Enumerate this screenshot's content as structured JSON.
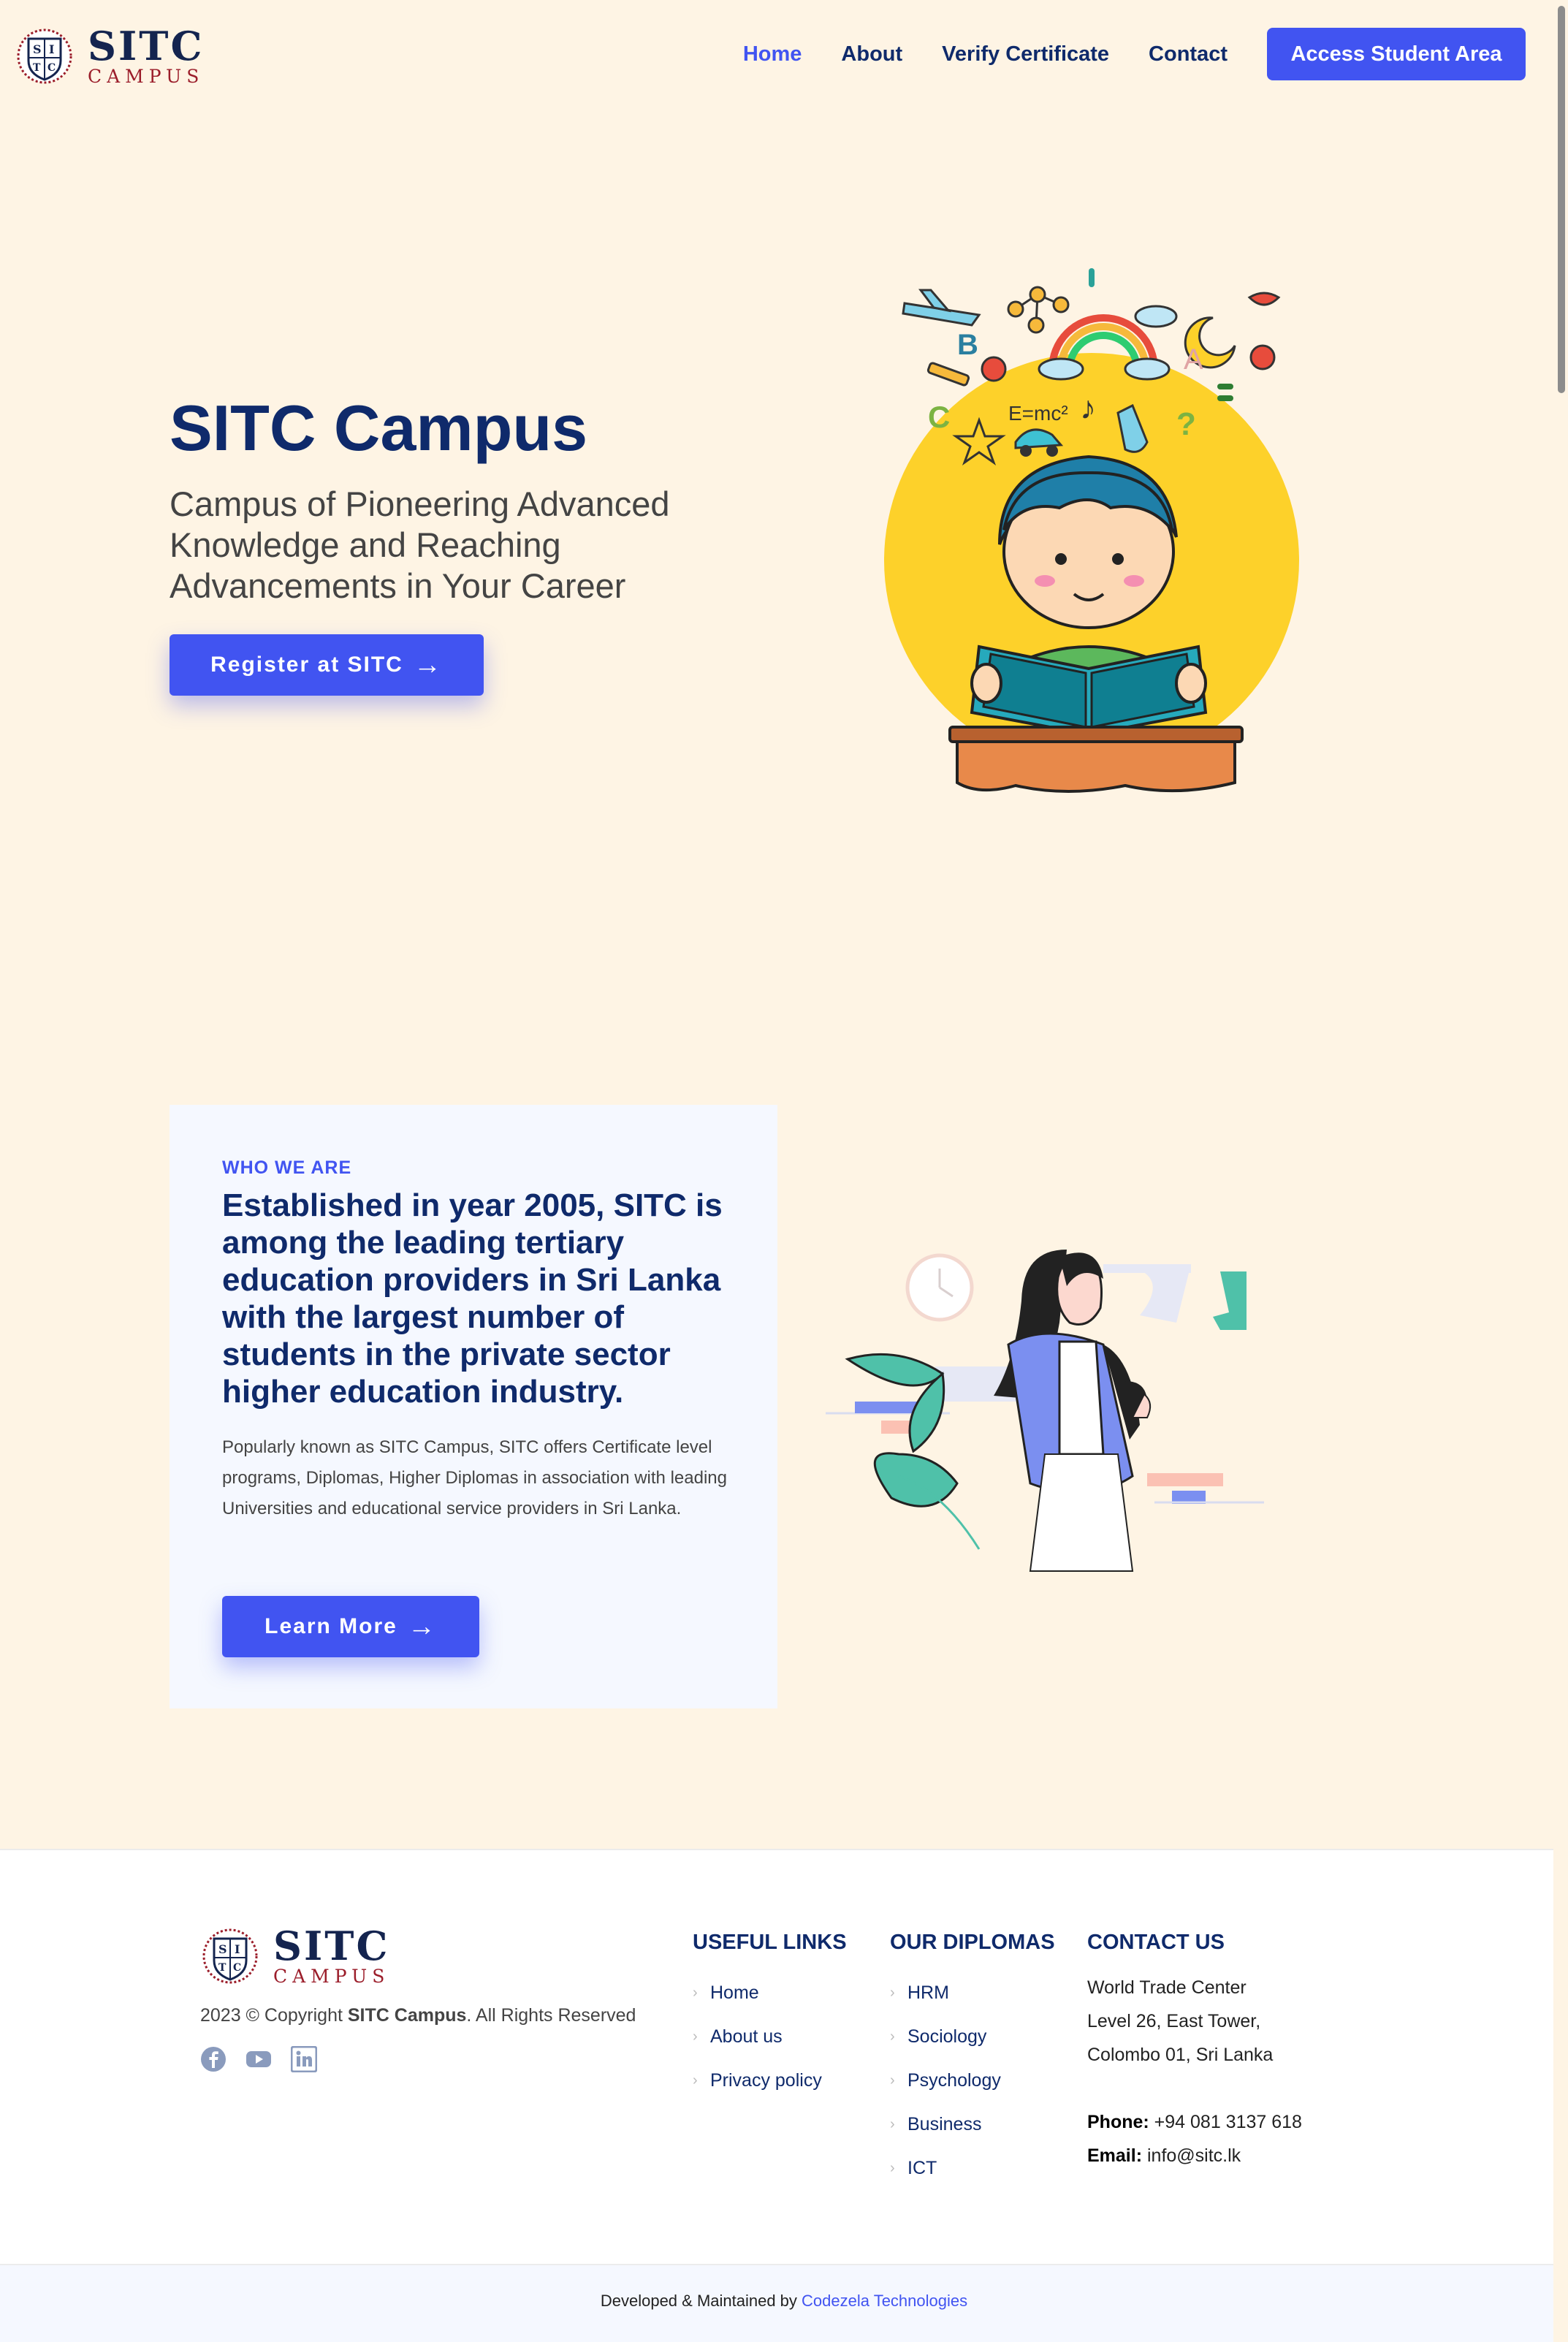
{
  "header": {
    "logo": {
      "line1": "SITC",
      "line2": "CAMPUS"
    },
    "nav": [
      {
        "label": "Home",
        "active": true
      },
      {
        "label": "About"
      },
      {
        "label": "Verify Certificate"
      },
      {
        "label": "Contact"
      }
    ],
    "cta_label": "Access Student Area"
  },
  "hero": {
    "title": "SITC Campus",
    "subtitle": "Campus of Pioneering Advanced Knowledge and Reaching Advancements in Your Career",
    "button_label": "Register at SITC",
    "art_icon": "student-reading-illustration"
  },
  "about": {
    "eyebrow": "WHO WE ARE",
    "heading": "Established in year 2005, SITC is among the leading tertiary education providers in Sri Lanka with the largest number of students in the private sector higher education industry.",
    "text": "Popularly known as SITC Campus, SITC offers Certificate level programs, Diplomas, Higher Diplomas in association with leading Universities and educational service providers in Sri Lanka.",
    "button_label": "Learn More",
    "art_icon": "woman-with-plants-illustration"
  },
  "footer": {
    "logo": {
      "line1": "SITC",
      "line2": "CAMPUS"
    },
    "copyright_prefix": "2023 © Copyright ",
    "copyright_brand": "SITC Campus",
    "copyright_suffix": ". All Rights Reserved",
    "socials": [
      "facebook-icon",
      "youtube-icon",
      "linkedin-icon"
    ],
    "useful_links": {
      "title": "USEFUL LINKS",
      "items": [
        "Home",
        "About us",
        "Privacy policy"
      ]
    },
    "diplomas": {
      "title": "OUR DIPLOMAS",
      "items": [
        "HRM",
        "Sociology",
        "Psychology",
        "Business",
        "ICT"
      ]
    },
    "contact": {
      "title": "CONTACT US",
      "address": [
        "World Trade Center",
        "Level 26, East Tower,",
        "Colombo 01, Sri Lanka"
      ],
      "phone_label": "Phone:",
      "phone": "+94 081 3137 618",
      "email_label": "Email:",
      "email": "info@sitc.lk"
    }
  },
  "bottom_bar": {
    "text": "Developed & Maintained by ",
    "link": "Codezela Technologies"
  },
  "colors": {
    "accent": "#4154f1",
    "navy": "#0f2a6b",
    "cream": "#fef4e4",
    "brand_red": "#9b1d2a"
  }
}
